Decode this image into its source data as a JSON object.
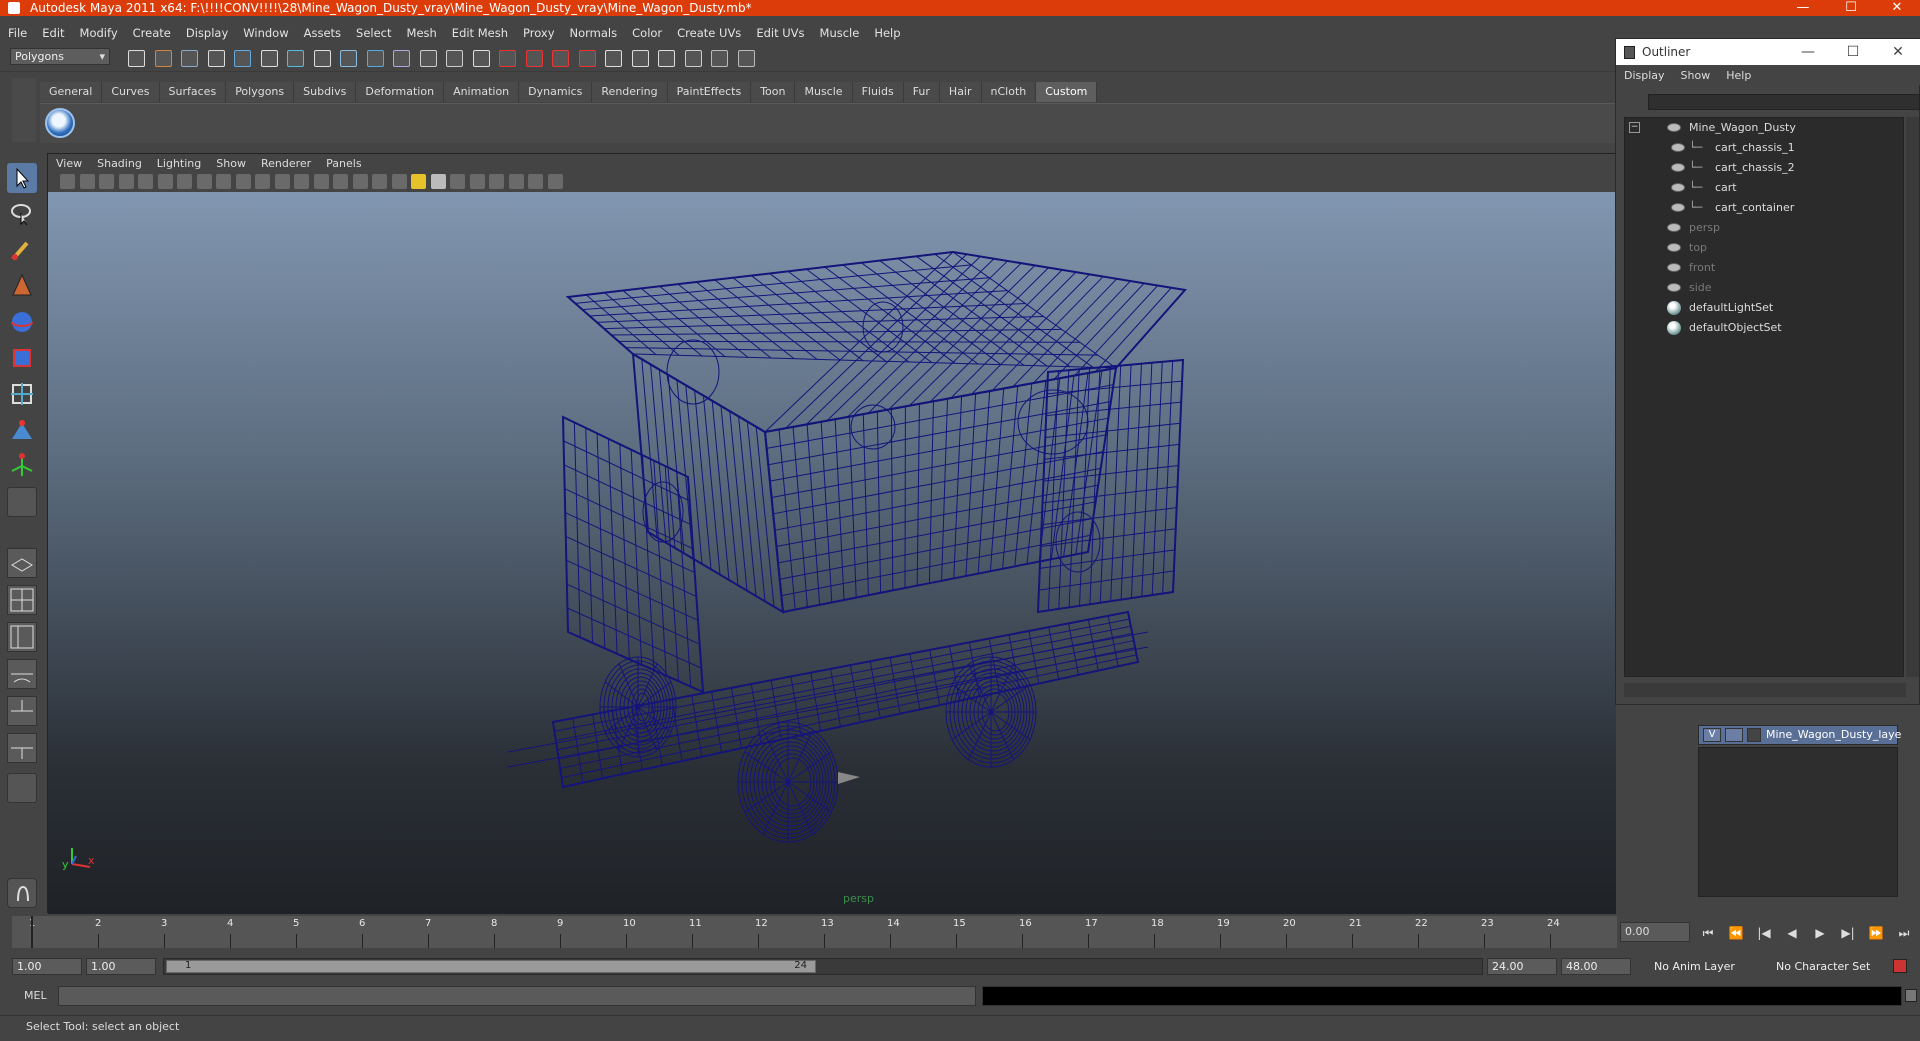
{
  "window": {
    "title": "Autodesk Maya 2011 x64: F:\\!!!!CONV!!!!\\28\\Mine_Wagon_Dusty_vray\\Mine_Wagon_Dusty_vray\\Mine_Wagon_Dusty.mb*",
    "minimize": "—",
    "maximize": "☐",
    "close": "✕"
  },
  "menubar": [
    "File",
    "Edit",
    "Modify",
    "Create",
    "Display",
    "Window",
    "Assets",
    "Select",
    "Mesh",
    "Edit Mesh",
    "Proxy",
    "Normals",
    "Color",
    "Create UVs",
    "Edit UVs",
    "Muscle",
    "Help"
  ],
  "statusline": {
    "mode": "Polygons"
  },
  "shelf": {
    "tabs": [
      "General",
      "Curves",
      "Surfaces",
      "Polygons",
      "Subdivs",
      "Deformation",
      "Animation",
      "Dynamics",
      "Rendering",
      "PaintEffects",
      "Toon",
      "Muscle",
      "Fluids",
      "Fur",
      "Hair",
      "nCloth",
      "Custom"
    ],
    "active": "Custom"
  },
  "viewport": {
    "menu": [
      "View",
      "Shading",
      "Lighting",
      "Show",
      "Renderer",
      "Panels"
    ],
    "camera": "persp",
    "wire_color": "#14147a",
    "axis": {
      "y": "y",
      "x": "x"
    }
  },
  "outliner": {
    "title": "Outliner",
    "menu": [
      "Display",
      "Show",
      "Help"
    ],
    "items": [
      {
        "label": "Mine_Wagon_Dusty",
        "dim": false,
        "indent": 0,
        "icon": "mesh-icon"
      },
      {
        "label": "cart_chassis_1",
        "dim": false,
        "indent": 1,
        "icon": "mesh-icon"
      },
      {
        "label": "cart_chassis_2",
        "dim": false,
        "indent": 1,
        "icon": "mesh-icon"
      },
      {
        "label": "cart",
        "dim": false,
        "indent": 1,
        "icon": "mesh-icon"
      },
      {
        "label": "cart_container",
        "dim": false,
        "indent": 1,
        "icon": "mesh-icon"
      },
      {
        "label": "persp",
        "dim": true,
        "indent": 0,
        "icon": "camera-icon"
      },
      {
        "label": "top",
        "dim": true,
        "indent": 0,
        "icon": "camera-icon"
      },
      {
        "label": "front",
        "dim": true,
        "indent": 0,
        "icon": "camera-icon"
      },
      {
        "label": "side",
        "dim": true,
        "indent": 0,
        "icon": "camera-icon"
      },
      {
        "label": "defaultLightSet",
        "dim": false,
        "indent": 0,
        "icon": "set-icon"
      },
      {
        "label": "defaultObjectSet",
        "dim": false,
        "indent": 0,
        "icon": "set-icon"
      }
    ]
  },
  "layers": {
    "row": {
      "visible": "V",
      "name": "Mine_Wagon_Dusty_laye"
    }
  },
  "timeline": {
    "ticks": [
      1,
      2,
      3,
      4,
      5,
      6,
      7,
      8,
      9,
      10,
      11,
      12,
      13,
      14,
      15,
      16,
      17,
      18,
      19,
      20,
      21,
      22,
      23,
      24
    ],
    "current_time": "0.00"
  },
  "range": {
    "start": "1.00",
    "playback_start": "1.00",
    "handle_start": "1",
    "handle_end": "24",
    "playback_end": "24.00",
    "end": "48.00",
    "anim_layer": "No Anim Layer",
    "character_set": "No Character Set"
  },
  "playback": [
    "⏮",
    "⏪",
    "|◀",
    "◀",
    "▶",
    "▶|",
    "⏩",
    "⏭"
  ],
  "cmdline": {
    "label": "MEL"
  },
  "helpline": {
    "text": "Select Tool: select an object"
  }
}
